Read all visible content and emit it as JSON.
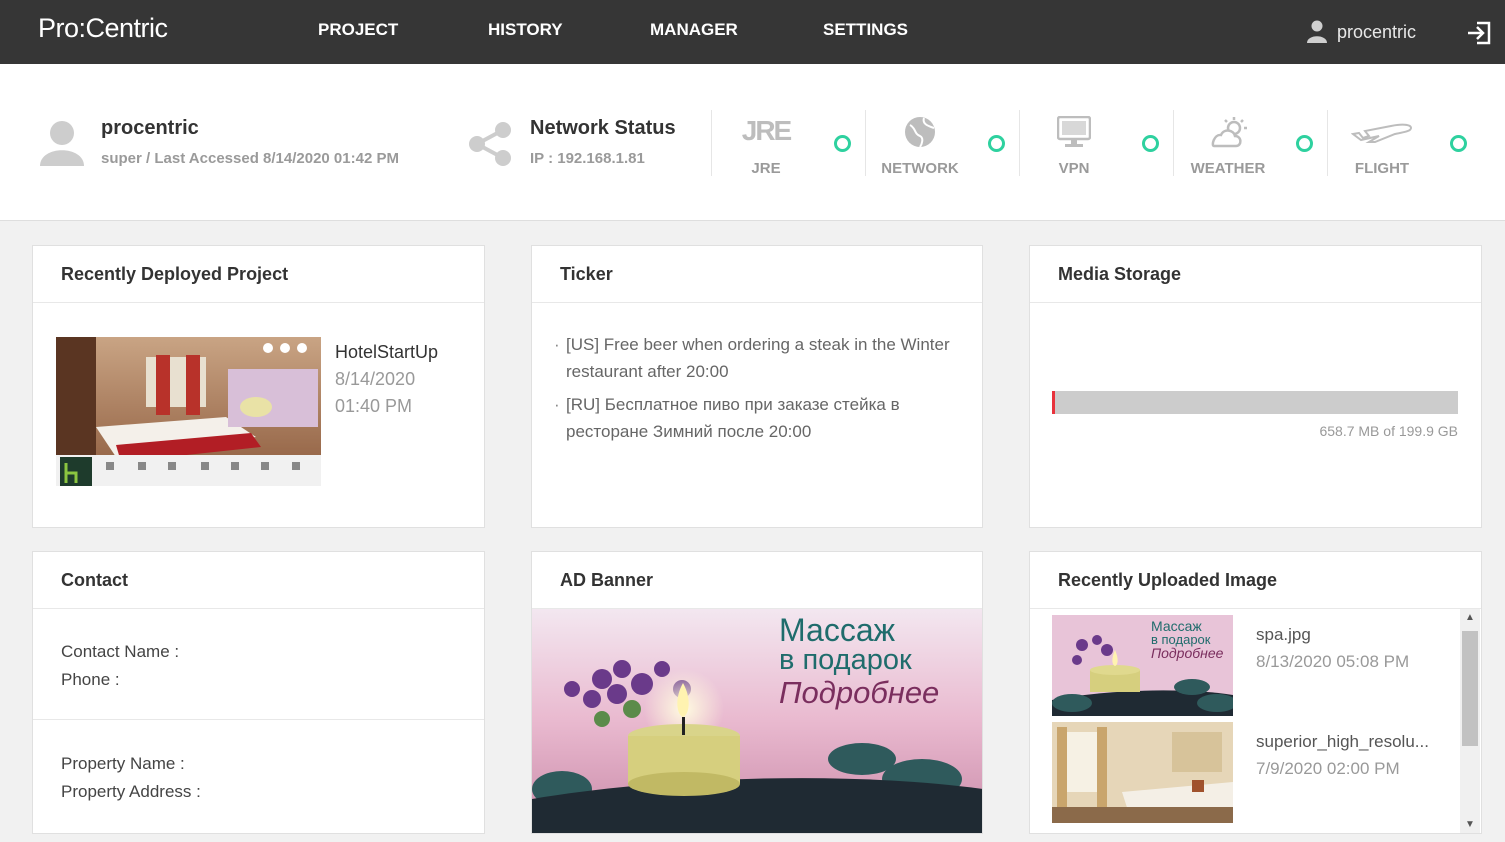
{
  "app": {
    "logo_text": "Pro:Centric"
  },
  "nav": {
    "items": [
      "PROJECT",
      "HISTORY",
      "MANAGER",
      "SETTINGS"
    ]
  },
  "user": {
    "name": "procentric"
  },
  "status": {
    "user_name": "procentric",
    "user_sub": "super / Last Accessed 8/14/2020 01:42 PM",
    "network_title": "Network Status",
    "network_ip": "IP : 192.168.1.81",
    "services": [
      {
        "label": "JRE",
        "icon": "jre-icon",
        "status_color": "#2ed19f"
      },
      {
        "label": "NETWORK",
        "icon": "globe-icon",
        "status_color": "#2ed19f"
      },
      {
        "label": "VPN",
        "icon": "monitor-icon",
        "status_color": "#2ed19f"
      },
      {
        "label": "WEATHER",
        "icon": "weather-icon",
        "status_color": "#2ed19f"
      },
      {
        "label": "FLIGHT",
        "icon": "airplane-icon",
        "status_color": "#2ed19f"
      }
    ],
    "jre_glyph": "JRE"
  },
  "recent_project": {
    "title": "Recently Deployed Project",
    "name": "HotelStartUp",
    "date": "8/14/2020",
    "time": "01:40 PM"
  },
  "ticker": {
    "title": "Ticker",
    "items": [
      "[US] Free beer when ordering a steak in the Winter restaurant after 20:00",
      "[RU] Бесплатное пиво при заказе стейка в ресторане Зимний после 20:00"
    ]
  },
  "media_storage": {
    "title": "Media Storage",
    "used_fraction": 0.0033,
    "text": "658.7 MB of 199.9 GB"
  },
  "contact": {
    "title": "Contact",
    "contact_name_label": "Contact Name :",
    "phone_label": "Phone :",
    "property_name_label": "Property Name :",
    "property_address_label": "Property Address :"
  },
  "ad_banner": {
    "title": "AD Banner",
    "line1": "Массаж",
    "line2": "в подарок",
    "line3": "Подробнее"
  },
  "recent_images": {
    "title": "Recently Uploaded Image",
    "items": [
      {
        "name": "spa.jpg",
        "date": "8/13/2020 05:08 PM"
      },
      {
        "name": "superior_high_resolu...",
        "date": "7/9/2020 02:00 PM"
      }
    ],
    "thumb_spa_text1": "Массаж",
    "thumb_spa_text2": "в подарок",
    "thumb_spa_text3": "Подробнее"
  }
}
